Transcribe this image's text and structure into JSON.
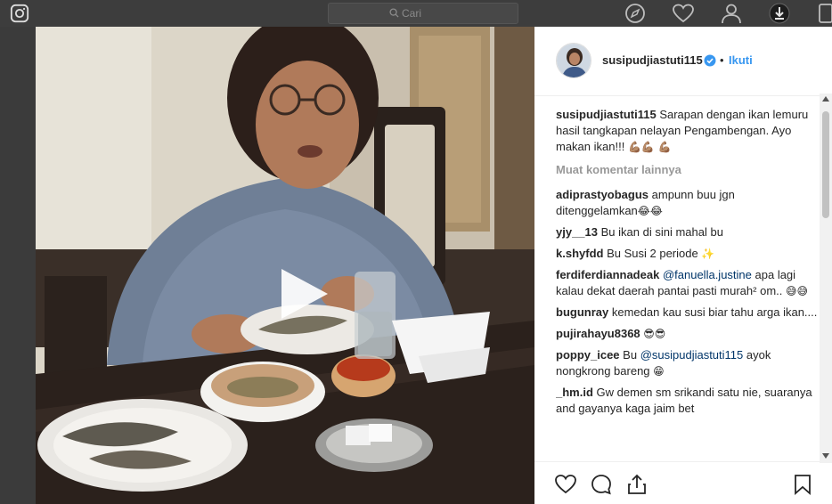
{
  "nav": {
    "search_placeholder": "Cari"
  },
  "post": {
    "username": "susipudjiastuti115",
    "follow_label": "Ikuti",
    "dot": "•",
    "caption_user": "susipudjiastuti115",
    "caption_text": "Sarapan dengan ikan lemuru hasil tangkapan nelayan Pengambengan. Ayo makan ikan!!!",
    "caption_emoji": "💪🏽💪🏽 💪🏽",
    "load_more": "Muat komentar lainnya"
  },
  "comments": [
    {
      "user": "adiprastyobagus",
      "text": "ampunn buu jgn ditenggelamkan",
      "emoji": "😂😂"
    },
    {
      "user": "yjy__13",
      "text": "Bu ikan di sini mahal bu",
      "emoji": ""
    },
    {
      "user": "k.shyfdd",
      "text": "Bu Susi 2 periode",
      "emoji": "✨"
    },
    {
      "user": "ferdiferdiannadeak",
      "mention": "@fanuella.justine",
      "text": "apa lagi kalau dekat daerah pantai pasti murah² om..",
      "emoji": "😅😅"
    },
    {
      "user": "bugunray",
      "text": "kemedan kau susi biar tahu arga ikan....",
      "emoji": ""
    },
    {
      "user": "pujirahayu8368",
      "text": "",
      "emoji": "😎😎"
    },
    {
      "user": "poppy_icee",
      "pre": "Bu",
      "mention": "@susipudjiastuti115",
      "text": "ayok nongkrong bareng",
      "emoji": "😁"
    },
    {
      "user": "_hm.id",
      "text": "Gw demen sm srikandi satu nie, suaranya and gayanya kaga jaim bet",
      "emoji": ""
    }
  ],
  "colors": {
    "link": "#3897f0",
    "mention": "#003569",
    "muted": "#999999"
  }
}
